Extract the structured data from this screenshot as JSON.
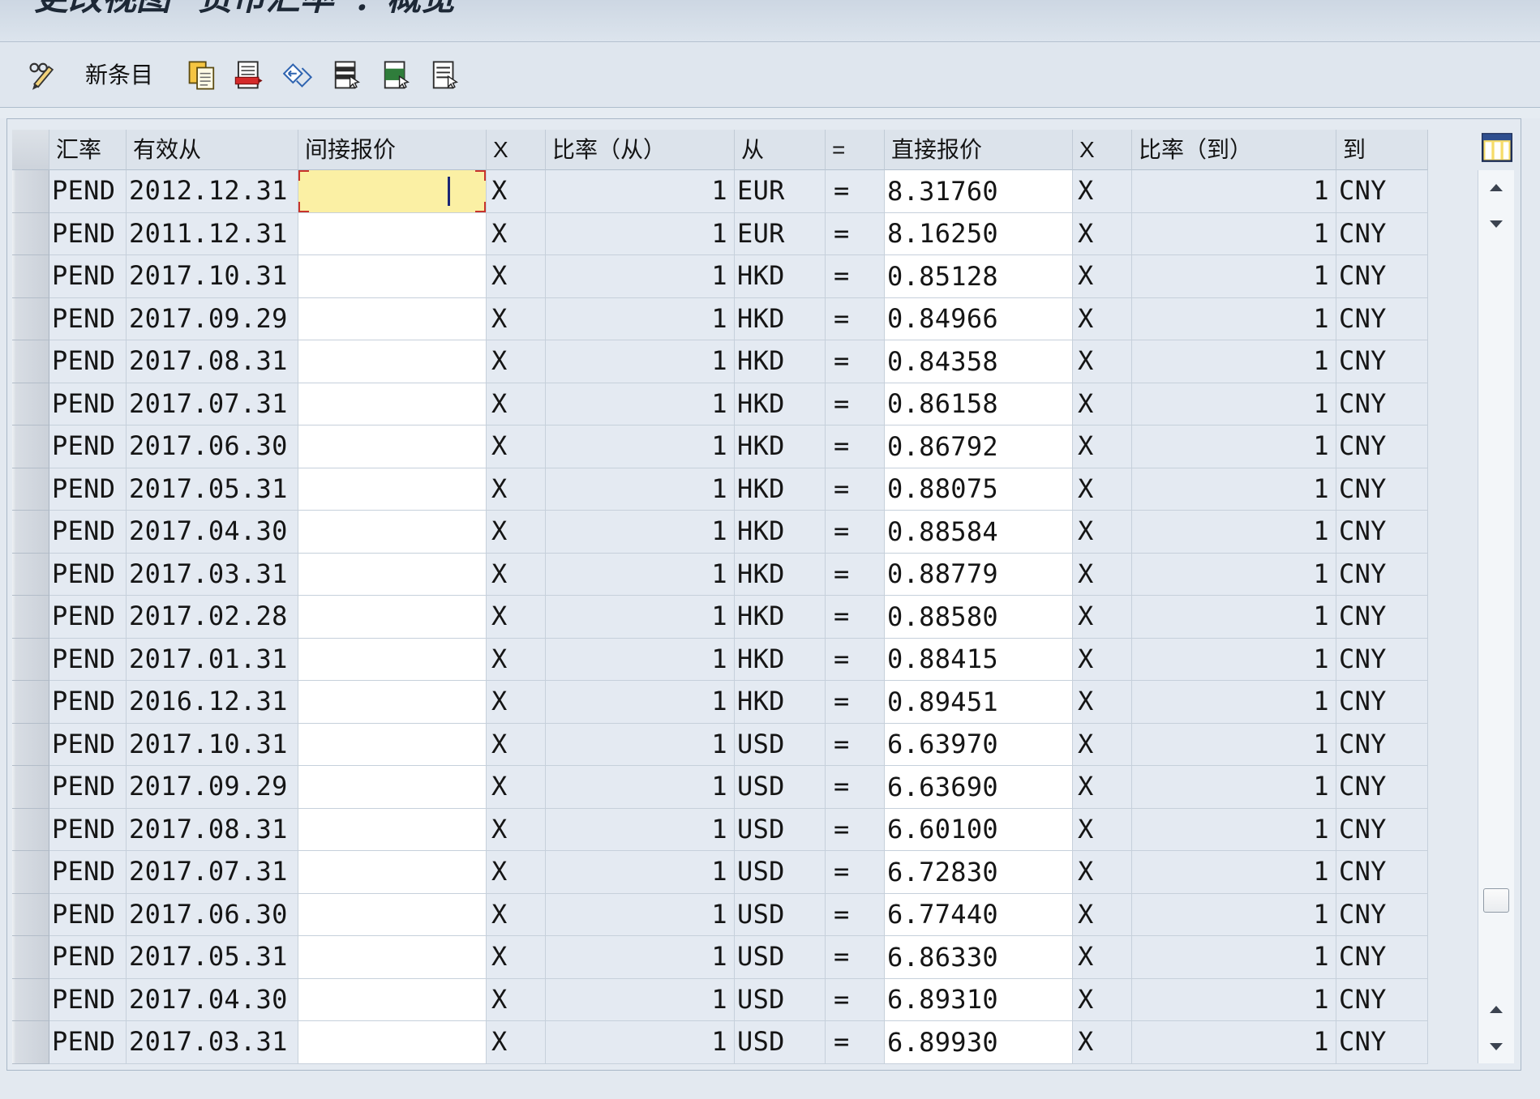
{
  "window": {
    "title": "更改视图 \"货币汇率\"：概览"
  },
  "toolbar": {
    "new_entries_label": "新条目",
    "icons": [
      "display-change-icon",
      "copy-as-icon",
      "delete-icon",
      "undo-change-icon",
      "select-all-icon",
      "select-block-icon",
      "deselect-all-icon"
    ]
  },
  "table": {
    "columns": [
      "汇率",
      "有效从",
      "间接报价",
      "X",
      "比率（从）",
      "从",
      "=",
      "直接报价",
      "X",
      "比率（到）",
      "到"
    ],
    "rows": [
      {
        "type": "PEND",
        "valid_from": "2012.12.31",
        "indirect": "",
        "indirect_x": "X",
        "ratio_from": "1",
        "from": "EUR",
        "equals": "=",
        "direct": "8.31760",
        "direct_x": "X",
        "ratio_to": "1",
        "to": "CNY"
      },
      {
        "type": "PEND",
        "valid_from": "2011.12.31",
        "indirect": "",
        "indirect_x": "X",
        "ratio_from": "1",
        "from": "EUR",
        "equals": "=",
        "direct": "8.16250",
        "direct_x": "X",
        "ratio_to": "1",
        "to": "CNY"
      },
      {
        "type": "PEND",
        "valid_from": "2017.10.31",
        "indirect": "",
        "indirect_x": "X",
        "ratio_from": "1",
        "from": "HKD",
        "equals": "=",
        "direct": "0.85128",
        "direct_x": "X",
        "ratio_to": "1",
        "to": "CNY"
      },
      {
        "type": "PEND",
        "valid_from": "2017.09.29",
        "indirect": "",
        "indirect_x": "X",
        "ratio_from": "1",
        "from": "HKD",
        "equals": "=",
        "direct": "0.84966",
        "direct_x": "X",
        "ratio_to": "1",
        "to": "CNY"
      },
      {
        "type": "PEND",
        "valid_from": "2017.08.31",
        "indirect": "",
        "indirect_x": "X",
        "ratio_from": "1",
        "from": "HKD",
        "equals": "=",
        "direct": "0.84358",
        "direct_x": "X",
        "ratio_to": "1",
        "to": "CNY"
      },
      {
        "type": "PEND",
        "valid_from": "2017.07.31",
        "indirect": "",
        "indirect_x": "X",
        "ratio_from": "1",
        "from": "HKD",
        "equals": "=",
        "direct": "0.86158",
        "direct_x": "X",
        "ratio_to": "1",
        "to": "CNY"
      },
      {
        "type": "PEND",
        "valid_from": "2017.06.30",
        "indirect": "",
        "indirect_x": "X",
        "ratio_from": "1",
        "from": "HKD",
        "equals": "=",
        "direct": "0.86792",
        "direct_x": "X",
        "ratio_to": "1",
        "to": "CNY"
      },
      {
        "type": "PEND",
        "valid_from": "2017.05.31",
        "indirect": "",
        "indirect_x": "X",
        "ratio_from": "1",
        "from": "HKD",
        "equals": "=",
        "direct": "0.88075",
        "direct_x": "X",
        "ratio_to": "1",
        "to": "CNY"
      },
      {
        "type": "PEND",
        "valid_from": "2017.04.30",
        "indirect": "",
        "indirect_x": "X",
        "ratio_from": "1",
        "from": "HKD",
        "equals": "=",
        "direct": "0.88584",
        "direct_x": "X",
        "ratio_to": "1",
        "to": "CNY"
      },
      {
        "type": "PEND",
        "valid_from": "2017.03.31",
        "indirect": "",
        "indirect_x": "X",
        "ratio_from": "1",
        "from": "HKD",
        "equals": "=",
        "direct": "0.88779",
        "direct_x": "X",
        "ratio_to": "1",
        "to": "CNY"
      },
      {
        "type": "PEND",
        "valid_from": "2017.02.28",
        "indirect": "",
        "indirect_x": "X",
        "ratio_from": "1",
        "from": "HKD",
        "equals": "=",
        "direct": "0.88580",
        "direct_x": "X",
        "ratio_to": "1",
        "to": "CNY"
      },
      {
        "type": "PEND",
        "valid_from": "2017.01.31",
        "indirect": "",
        "indirect_x": "X",
        "ratio_from": "1",
        "from": "HKD",
        "equals": "=",
        "direct": "0.88415",
        "direct_x": "X",
        "ratio_to": "1",
        "to": "CNY"
      },
      {
        "type": "PEND",
        "valid_from": "2016.12.31",
        "indirect": "",
        "indirect_x": "X",
        "ratio_from": "1",
        "from": "HKD",
        "equals": "=",
        "direct": "0.89451",
        "direct_x": "X",
        "ratio_to": "1",
        "to": "CNY"
      },
      {
        "type": "PEND",
        "valid_from": "2017.10.31",
        "indirect": "",
        "indirect_x": "X",
        "ratio_from": "1",
        "from": "USD",
        "equals": "=",
        "direct": "6.63970",
        "direct_x": "X",
        "ratio_to": "1",
        "to": "CNY"
      },
      {
        "type": "PEND",
        "valid_from": "2017.09.29",
        "indirect": "",
        "indirect_x": "X",
        "ratio_from": "1",
        "from": "USD",
        "equals": "=",
        "direct": "6.63690",
        "direct_x": "X",
        "ratio_to": "1",
        "to": "CNY"
      },
      {
        "type": "PEND",
        "valid_from": "2017.08.31",
        "indirect": "",
        "indirect_x": "X",
        "ratio_from": "1",
        "from": "USD",
        "equals": "=",
        "direct": "6.60100",
        "direct_x": "X",
        "ratio_to": "1",
        "to": "CNY"
      },
      {
        "type": "PEND",
        "valid_from": "2017.07.31",
        "indirect": "",
        "indirect_x": "X",
        "ratio_from": "1",
        "from": "USD",
        "equals": "=",
        "direct": "6.72830",
        "direct_x": "X",
        "ratio_to": "1",
        "to": "CNY"
      },
      {
        "type": "PEND",
        "valid_from": "2017.06.30",
        "indirect": "",
        "indirect_x": "X",
        "ratio_from": "1",
        "from": "USD",
        "equals": "=",
        "direct": "6.77440",
        "direct_x": "X",
        "ratio_to": "1",
        "to": "CNY"
      },
      {
        "type": "PEND",
        "valid_from": "2017.05.31",
        "indirect": "",
        "indirect_x": "X",
        "ratio_from": "1",
        "from": "USD",
        "equals": "=",
        "direct": "6.86330",
        "direct_x": "X",
        "ratio_to": "1",
        "to": "CNY"
      },
      {
        "type": "PEND",
        "valid_from": "2017.04.30",
        "indirect": "",
        "indirect_x": "X",
        "ratio_from": "1",
        "from": "USD",
        "equals": "=",
        "direct": "6.89310",
        "direct_x": "X",
        "ratio_to": "1",
        "to": "CNY"
      },
      {
        "type": "PEND",
        "valid_from": "2017.03.31",
        "indirect": "",
        "indirect_x": "X",
        "ratio_from": "1",
        "from": "USD",
        "equals": "=",
        "direct": "6.89930",
        "direct_x": "X",
        "ratio_to": "1",
        "to": "CNY"
      }
    ]
  },
  "colors": {
    "focused_cell": "#fbf0a4",
    "focus_marker": "#c8332b",
    "input_cell": "#ffffff",
    "readonly_cell": "#e4eaf2",
    "header": "#dce3eb"
  }
}
